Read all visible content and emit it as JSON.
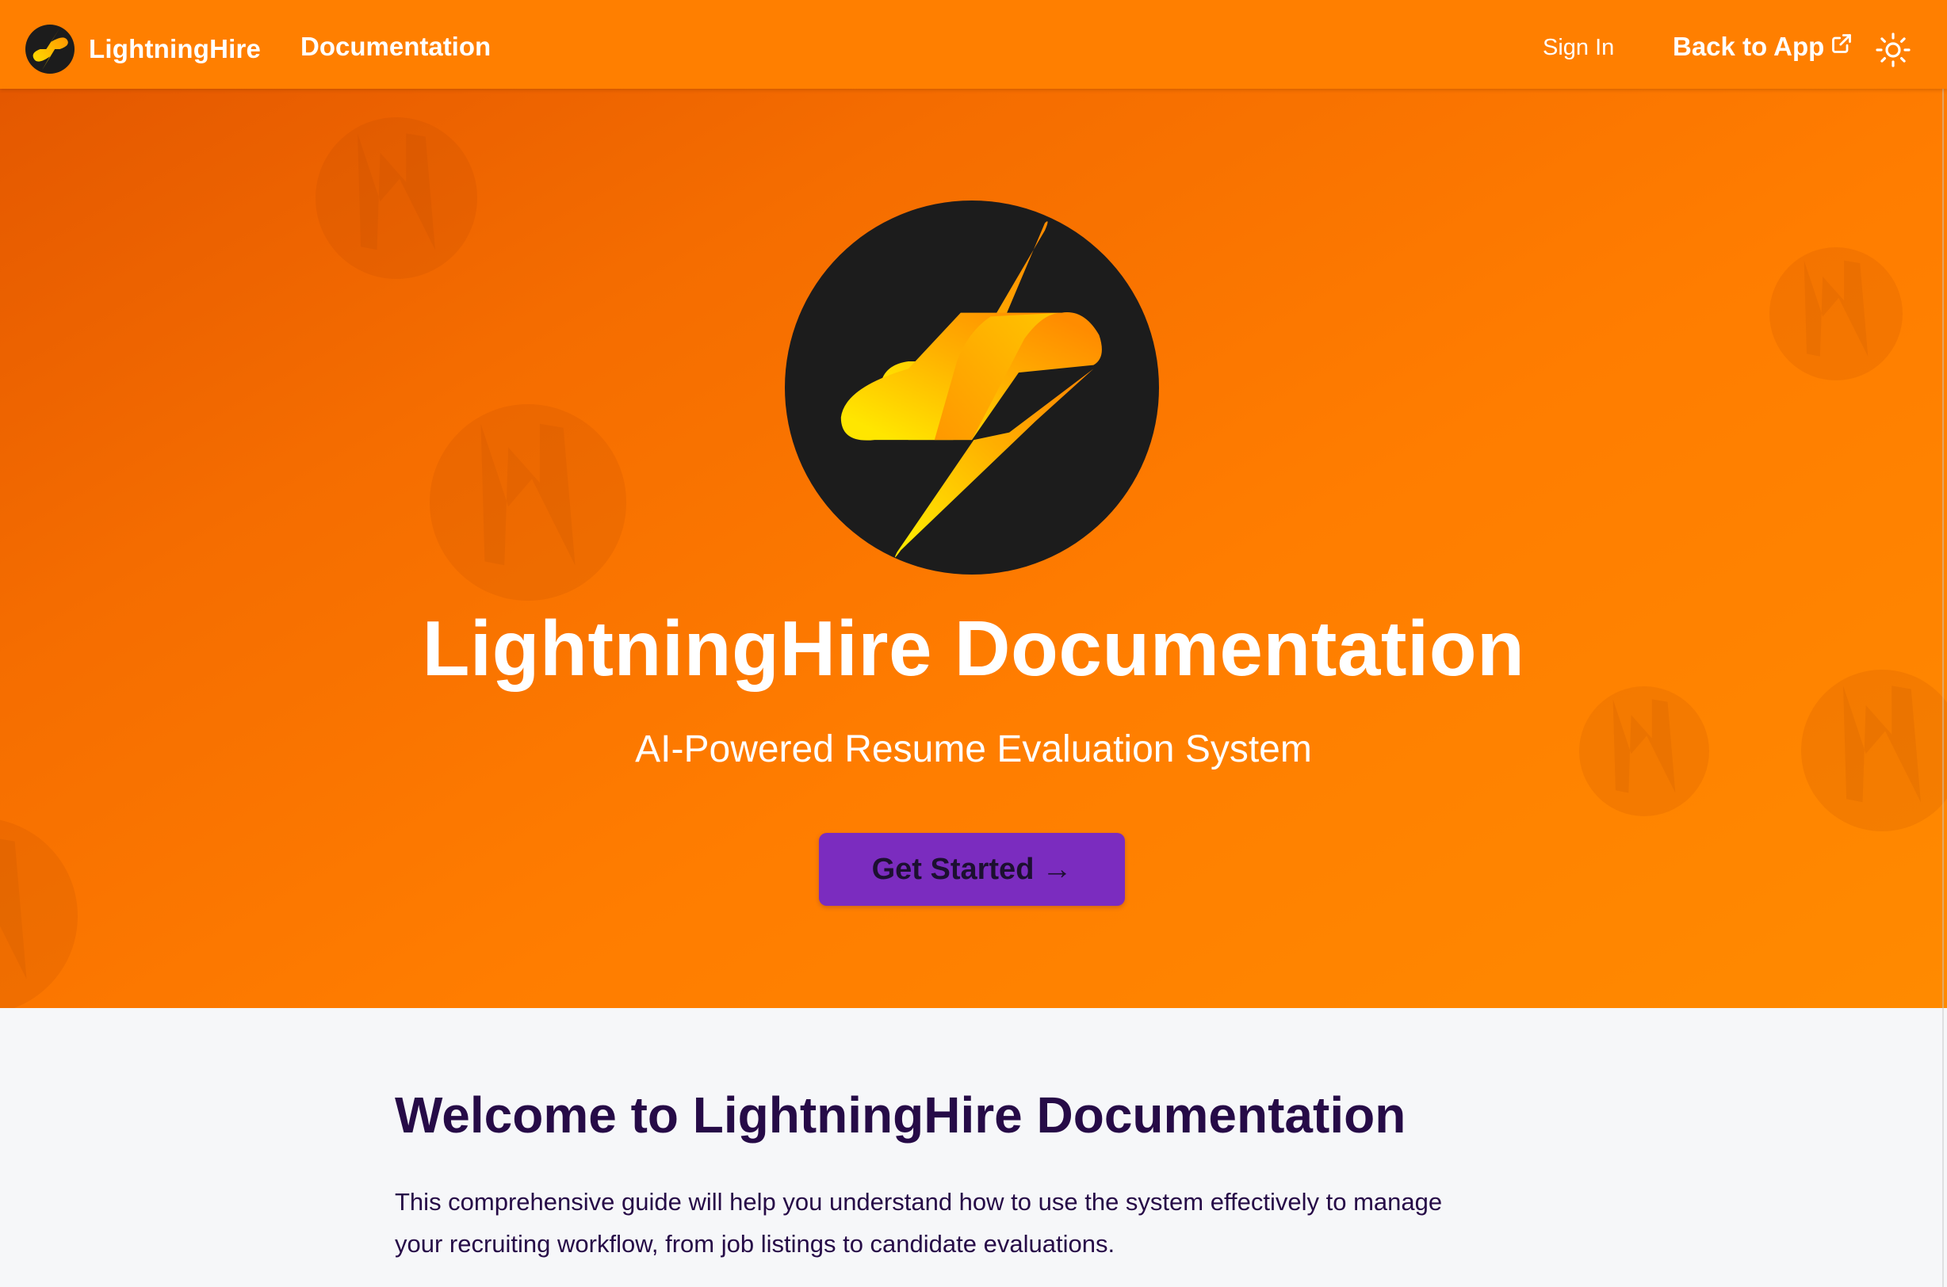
{
  "navbar": {
    "brand_name": "LightningHire",
    "documentation_link": "Documentation",
    "sign_in_link": "Sign In",
    "back_to_app_link": "Back to App",
    "icons": [
      "lightning-logo-icon",
      "external-link-icon",
      "sun-icon"
    ]
  },
  "hero": {
    "title": "LightningHire Documentation",
    "subtitle": "AI-Powered Resume Evaluation System",
    "cta_label": "Get Started",
    "cta_arrow": "→",
    "logo_icon": "lightning-logo-icon"
  },
  "content": {
    "heading": "Welcome to LightningHire Documentation",
    "intro": "This comprehensive guide will help you understand how to use the system effectively to manage your recruiting workflow, from job listings to candidate evaluations."
  },
  "colors": {
    "navbar_bg": "#ff7f00",
    "hero_gradient_start": "#e45800",
    "hero_gradient_end": "#ff8a00",
    "cta_bg": "#7b2cbf",
    "heading_text": "#260b47",
    "logo_circle": "#1c1c1c",
    "bolt_yellow": "#ffe600",
    "bolt_orange": "#ff8c00"
  }
}
